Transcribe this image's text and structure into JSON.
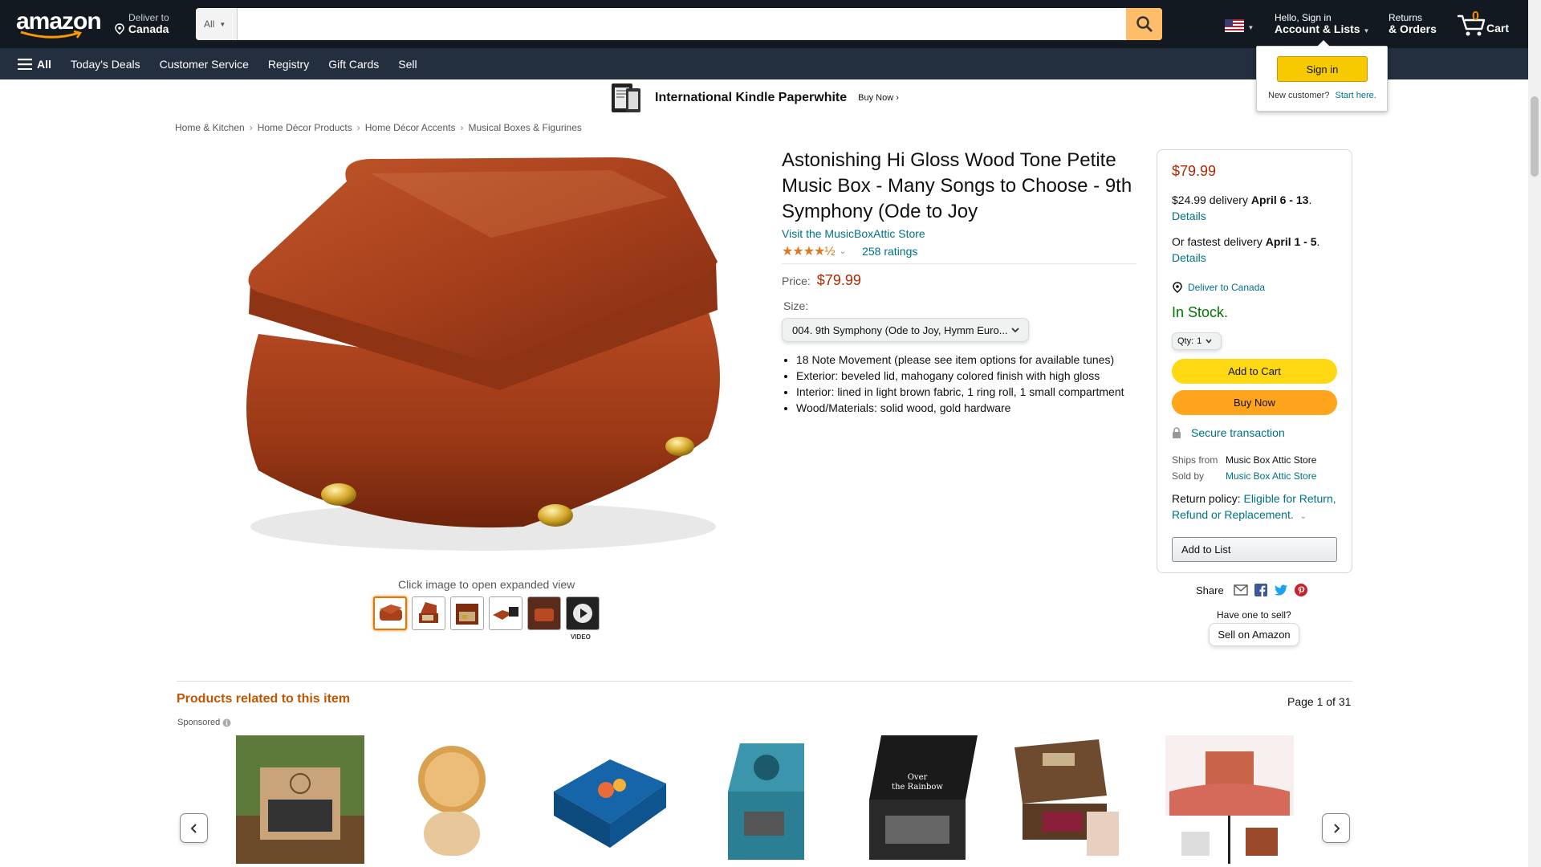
{
  "nav": {
    "logo_text": "amazon",
    "deliver_line1": "Deliver to",
    "deliver_line2": "Canada",
    "search_category": "All",
    "search_placeholder": "",
    "account_line1": "Hello, Sign in",
    "account_line2": "Account & Lists",
    "returns_line1": "Returns",
    "returns_line2": "& Orders",
    "cart_count": "0",
    "cart_label": "Cart"
  },
  "subnav": {
    "all": "All",
    "items": [
      "Today's Deals",
      "Customer Service",
      "Registry",
      "Gift Cards",
      "Sell"
    ]
  },
  "banner": {
    "text": "International Kindle Paperwhite",
    "cta": "Buy Now ›"
  },
  "signin_popup": {
    "button": "Sign in",
    "new_customer": "New customer?",
    "start_here": "Start here."
  },
  "breadcrumb": [
    "Home & Kitchen",
    "Home Décor Products",
    "Home Décor Accents",
    "Musical Boxes & Figurines"
  ],
  "product": {
    "title": "Astonishing Hi Gloss Wood Tone Petite Music Box - Many Songs to Choose - 9th Symphony (Ode to Joy",
    "store": "Visit the MusicBoxAttic Store",
    "stars": "★★★★½",
    "ratings": "258 ratings",
    "price_label": "Price:",
    "price": "$79.99",
    "size_label": "Size:",
    "size_value": "004. 9th Symphony (Ode to Joy, Hymm Euro...",
    "bullets": [
      "18 Note Movement (please see item options for available tunes)",
      "Exterior: beveled lid, mahogany colored finish with high gloss",
      "Interior: lined in light brown fabric, 1 ring roll, 1 small compartment",
      "Wood/Materials: solid wood, gold hardware"
    ],
    "click_hint": "Click image to open expanded view",
    "video_label": "VIDEO"
  },
  "buybox": {
    "price": "$79.99",
    "delivery1_prefix": "$24.99 delivery ",
    "delivery1_date": "April 6 - 13",
    "delivery1_suffix": ".",
    "details1": "Details",
    "delivery2_prefix": "Or fastest delivery ",
    "delivery2_date": "April 1 - 5",
    "delivery2_suffix": ".",
    "details2": "Details",
    "deliver_to": "Deliver to Canada",
    "stock": "In Stock.",
    "qty_label": "Qty:",
    "qty_value": "1",
    "add_to_cart": "Add to Cart",
    "buy_now": "Buy Now",
    "secure": "Secure transaction",
    "ships_from_label": "Ships from",
    "ships_from_value": "Music Box Attic Store",
    "sold_by_label": "Sold by",
    "sold_by_value": "Music Box Attic Store",
    "return_label": "Return policy: ",
    "return_link": "Eligible for Return, Refund or Replacement.",
    "add_to_list": "Add to List"
  },
  "share": {
    "label": "Share",
    "have_one": "Have one to sell?",
    "sell_button": "Sell on Amazon"
  },
  "related": {
    "title": "Products related to this item",
    "page_info": "Page 1 of 31",
    "sponsored": "Sponsored"
  },
  "colors": {
    "nav_bg": "#131921",
    "subnav_bg": "#232f3e",
    "price_red": "#b12704",
    "stock_green": "#007600",
    "link_teal": "#007185",
    "add_to_cart": "#ffd814",
    "buy_now": "#ffa41c",
    "related_orange": "#c45500"
  }
}
